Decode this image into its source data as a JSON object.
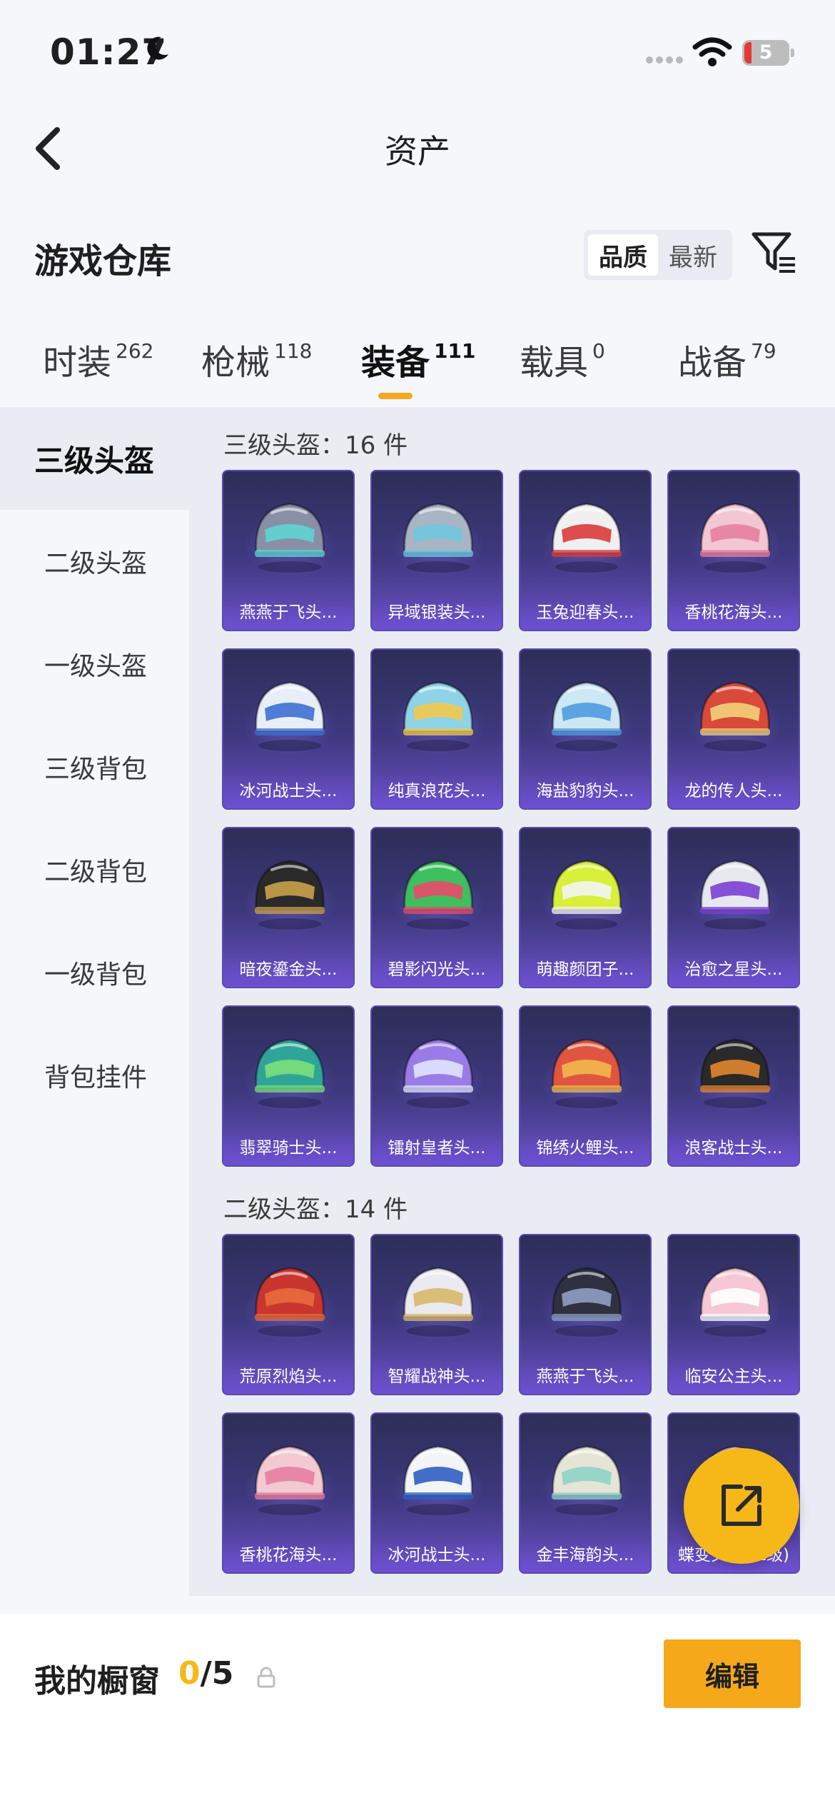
{
  "status_bar": {
    "time": "01:27",
    "battery": "5"
  },
  "nav": {
    "title": "资产"
  },
  "header": {
    "title": "游戏仓库",
    "sort_options": [
      "品质",
      "最新"
    ],
    "active_sort": "品质"
  },
  "tabs": [
    {
      "label": "时装",
      "count": "262"
    },
    {
      "label": "枪械",
      "count": "118"
    },
    {
      "label": "装备",
      "count": "111"
    },
    {
      "label": "载具",
      "count": "0"
    },
    {
      "label": "战备",
      "count": "79"
    }
  ],
  "sidebar": {
    "items": [
      "三级头盔",
      "二级头盔",
      "一级头盔",
      "三级背包",
      "二级背包",
      "一级背包",
      "背包挂件"
    ],
    "active": "三级头盔"
  },
  "sections": [
    {
      "title": "三级头盔：16 件",
      "items": [
        {
          "name": "燕燕于飞头...",
          "color": "#8a8fa8",
          "accent": "#5fd4d2"
        },
        {
          "name": "异域银装头...",
          "color": "#a9b4c4",
          "accent": "#6fc7e0"
        },
        {
          "name": "玉兔迎春头...",
          "color": "#f0f0f0",
          "accent": "#d93b3b"
        },
        {
          "name": "香桃花海头...",
          "color": "#f3c6d3",
          "accent": "#e77fa0"
        },
        {
          "name": "冰河战士头...",
          "color": "#e8eef7",
          "accent": "#3d6fd1"
        },
        {
          "name": "纯真浪花头...",
          "color": "#8fd3e6",
          "accent": "#f2c94c"
        },
        {
          "name": "海盐豹豹头...",
          "color": "#cde7f4",
          "accent": "#4f9be0"
        },
        {
          "name": "龙的传人头...",
          "color": "#d94a3a",
          "accent": "#f2d27a"
        },
        {
          "name": "暗夜鎏金头...",
          "color": "#2b2a2a",
          "accent": "#c9a14a"
        },
        {
          "name": "碧影闪光头...",
          "color": "#3fbf5f",
          "accent": "#e84a6b"
        },
        {
          "name": "萌趣颜团子...",
          "color": "#d8f03a",
          "accent": "#f4f4f4"
        },
        {
          "name": "治愈之星头...",
          "color": "#e6e8f0",
          "accent": "#7a3fd1"
        },
        {
          "name": "翡翠骑士头...",
          "color": "#2fa59a",
          "accent": "#7be07a"
        },
        {
          "name": "镭射皇者头...",
          "color": "#9a7be8",
          "accent": "#e0e4ff"
        },
        {
          "name": "锦绣火鲤头...",
          "color": "#e0553f",
          "accent": "#f2b94c"
        },
        {
          "name": "浪客战士头...",
          "color": "#2a2a2a",
          "accent": "#e3862f"
        }
      ]
    },
    {
      "title": "二级头盔：14 件",
      "items": [
        {
          "name": "荒原烈焰头...",
          "color": "#c9352f",
          "accent": "#e86b3a"
        },
        {
          "name": "智耀战神头...",
          "color": "#eaeaf0",
          "accent": "#d8b86a"
        },
        {
          "name": "燕燕于飞头...",
          "color": "#2f3140",
          "accent": "#8fa0c4"
        },
        {
          "name": "临安公主头...",
          "color": "#f6c8d6",
          "accent": "#ffffff"
        },
        {
          "name": "香桃花海头...",
          "color": "#f3c9d2",
          "accent": "#e77fa0"
        },
        {
          "name": "冰河战士头...",
          "color": "#f2f4f8",
          "accent": "#2f5fc4"
        },
        {
          "name": "金丰海韵头...",
          "color": "#e6e4d6",
          "accent": "#8fd3c8"
        },
        {
          "name": "蝶变头盔(二级)",
          "color": "#e8d3f0",
          "accent": "#b58ae0"
        }
      ]
    }
  ],
  "showcase": {
    "label": "我的橱窗",
    "used": "0",
    "total": "/5",
    "edit_label": "编辑"
  }
}
